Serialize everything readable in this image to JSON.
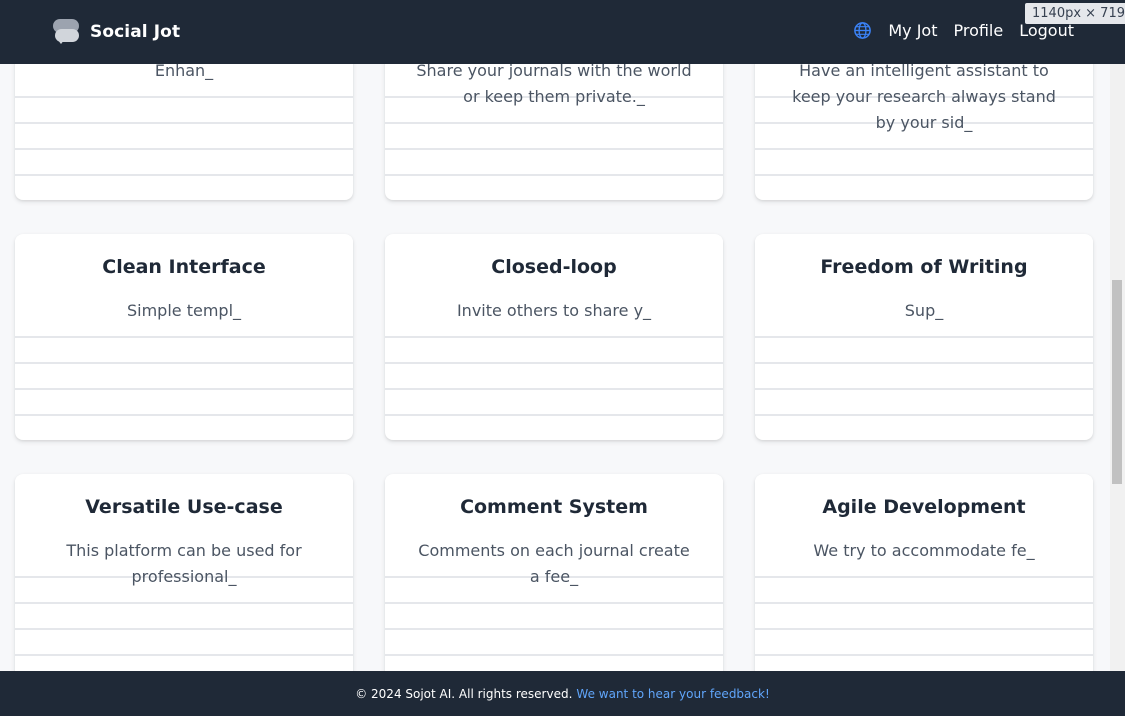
{
  "header": {
    "brand": "Social Jot",
    "nav": [
      "My Jot",
      "Profile",
      "Logout"
    ],
    "dimensions": "1140px × 719px"
  },
  "cards": [
    {
      "title": "",
      "description": "Enhan_"
    },
    {
      "title": "",
      "description": "Share your journals with the world or keep them private._"
    },
    {
      "title": "",
      "description": "Have an intelligent assistant to keep your research always stand by your sid_"
    },
    {
      "title": "Clean Interface",
      "description": "Simple templ_"
    },
    {
      "title": "Closed-loop",
      "description": "Invite others to share y_"
    },
    {
      "title": "Freedom of Writing",
      "description": "Sup_"
    },
    {
      "title": "Versatile Use-case",
      "description": "This platform can be used for professional_"
    },
    {
      "title": "Comment System",
      "description": "Comments on each journal create a fee_"
    },
    {
      "title": "Agile Development",
      "description": "We try to accommodate fe_"
    }
  ],
  "footer": {
    "copyright": "© 2024 Sojot AI. All rights reserved.",
    "feedback_link": "We want to hear your feedback!"
  },
  "colors": {
    "navbar_bg": "#1f2937",
    "page_bg": "#f7f8fa",
    "link_blue": "#60a5fa",
    "globe_blue": "#3b82f6"
  },
  "icons": [
    "chat-bubbles-logo-icon",
    "globe-icon"
  ]
}
